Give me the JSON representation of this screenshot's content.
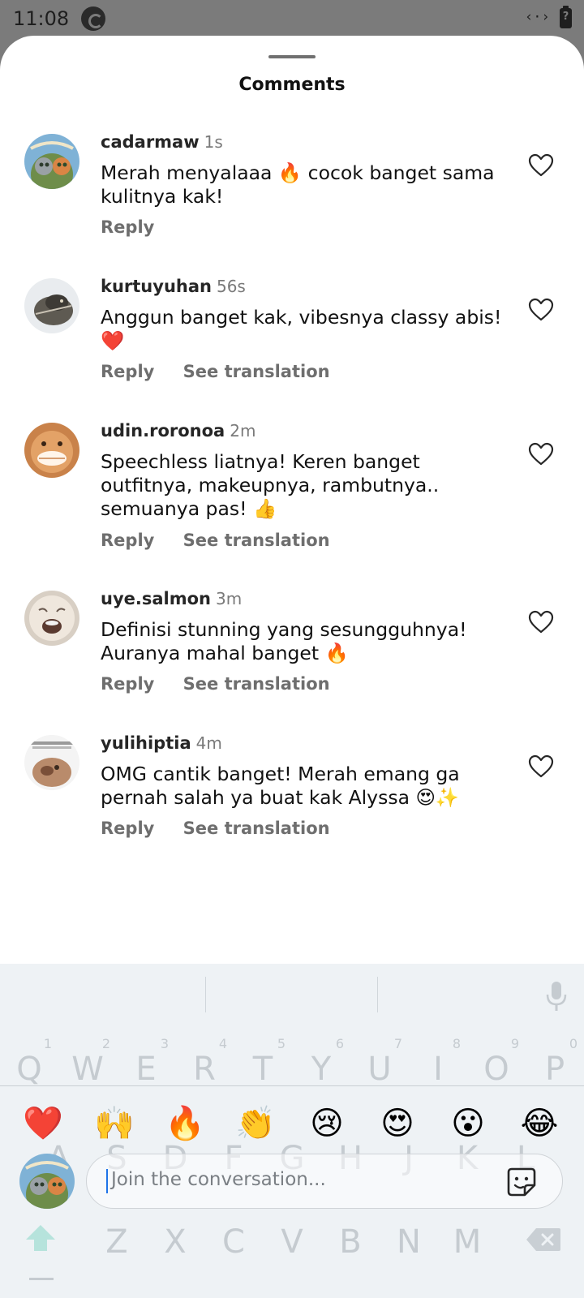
{
  "status_bar": {
    "time": "11:08",
    "code_icon": "‹·›",
    "battery_glyph": "?"
  },
  "sheet": {
    "title": "Comments"
  },
  "comments": [
    {
      "user": "cadarmaw",
      "time": "1s",
      "text": "Merah menyalaaa 🔥 cocok banget sama kulitnya kak!",
      "reply": "Reply",
      "translate": ""
    },
    {
      "user": "kurtuyuhan",
      "time": "56s",
      "text": "Anggun banget kak, vibesnya classy abis! ❤️",
      "reply": "Reply",
      "translate": "See translation"
    },
    {
      "user": "udin.roronoa",
      "time": "2m",
      "text": "Speechless liatnya! Keren banget outfitnya, makeupnya, rambutnya.. semuanya pas! 👍",
      "reply": "Reply",
      "translate": "See translation"
    },
    {
      "user": "uye.salmon",
      "time": "3m",
      "text": "Definisi stunning yang sesungguhnya! Auranya mahal banget 🔥",
      "reply": "Reply",
      "translate": "See translation"
    },
    {
      "user": "yulihiptia",
      "time": "4m",
      "text": "OMG cantik banget! Merah emang ga pernah salah ya buat kak Alyssa 😍✨",
      "reply": "Reply",
      "translate": "See translation"
    }
  ],
  "keyboard": {
    "numbers": [
      "1",
      "2",
      "3",
      "4",
      "5",
      "6",
      "7",
      "8",
      "9",
      "0"
    ],
    "row1": [
      "Q",
      "W",
      "E",
      "R",
      "T",
      "Y",
      "U",
      "I",
      "O",
      "P"
    ],
    "row2": [
      "A",
      "S",
      "D",
      "F",
      "G",
      "H",
      "J",
      "K",
      "L"
    ],
    "row3": [
      "Z",
      "X",
      "C",
      "V",
      "B",
      "N",
      "M"
    ]
  },
  "emoji_bar": [
    "❤️",
    "🙌",
    "🔥",
    "👏",
    "😢",
    "😍",
    "😮",
    "😂"
  ],
  "composer": {
    "placeholder": "Join the conversation..."
  },
  "colors": {
    "accent": "#1e73e8",
    "text": "#111111",
    "muted": "#6e6e6e",
    "heart_outline": "#262626"
  }
}
